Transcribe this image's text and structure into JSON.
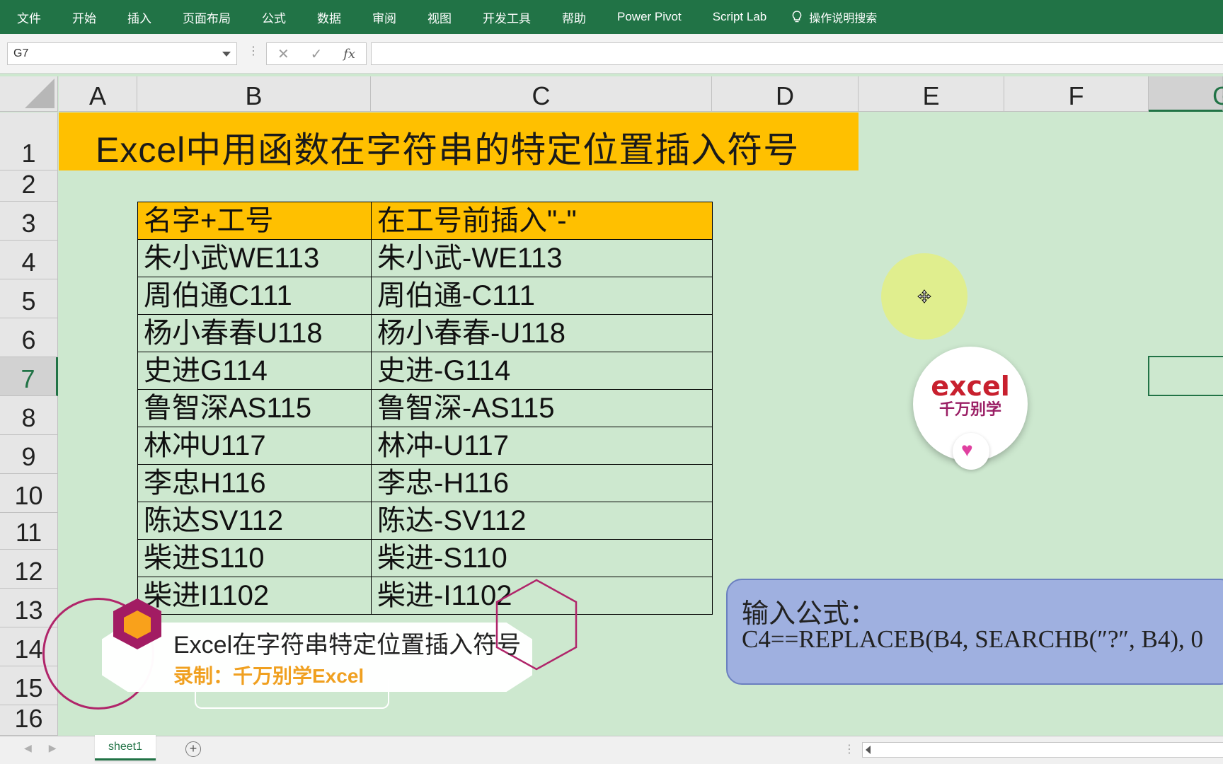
{
  "ribbon": {
    "tabs": [
      "文件",
      "开始",
      "插入",
      "页面布局",
      "公式",
      "数据",
      "审阅",
      "视图",
      "开发工具",
      "帮助",
      "Power Pivot",
      "Script Lab"
    ],
    "tell_me": "操作说明搜索"
  },
  "formula_bar": {
    "name_box": "G7",
    "fx": "fx",
    "content": ""
  },
  "columns": [
    "A",
    "B",
    "C",
    "D",
    "E",
    "F",
    "G"
  ],
  "rows": [
    "1",
    "2",
    "3",
    "4",
    "5",
    "6",
    "7",
    "8",
    "9",
    "10",
    "11",
    "12",
    "13",
    "14",
    "15",
    "16"
  ],
  "selected_cell": "G7",
  "sheet": {
    "title": "Excel中用函数在字符串的特定位置插入符号",
    "headers": [
      "名字+工号",
      "在工号前插入\"-\""
    ],
    "data": [
      [
        "朱小武WE113",
        "朱小武-WE113"
      ],
      [
        "周伯通C111",
        "周伯通-C111"
      ],
      [
        "杨小春春U118",
        "杨小春春-U118"
      ],
      [
        "史进G114",
        "史进-G114"
      ],
      [
        "鲁智深AS115",
        "鲁智深-AS115"
      ],
      [
        "林冲U117",
        "林冲-U117"
      ],
      [
        "李忠H116",
        "李忠-H116"
      ],
      [
        "陈达SV112",
        "陈达-SV112"
      ],
      [
        "柴进S110",
        "柴进-S110"
      ],
      [
        "柴进I1102",
        "柴进-I1102"
      ]
    ]
  },
  "overlay": {
    "logo_text": "excel",
    "logo_sub": "千万别学",
    "formula_label": "输入公式：",
    "formula": "C4==REPLACEB(B4, SEARCHB(″?″, B4), 0",
    "banner_title": "Excel在字符串特定位置插入符号",
    "banner_credit": "录制：千万别学Excel"
  },
  "sheet_tabs": [
    "sheet1"
  ],
  "colors": {
    "ribbon": "#217346",
    "background": "#cde8cf",
    "header_fill": "#ffc000",
    "formula_box": "#9fb0e0"
  }
}
